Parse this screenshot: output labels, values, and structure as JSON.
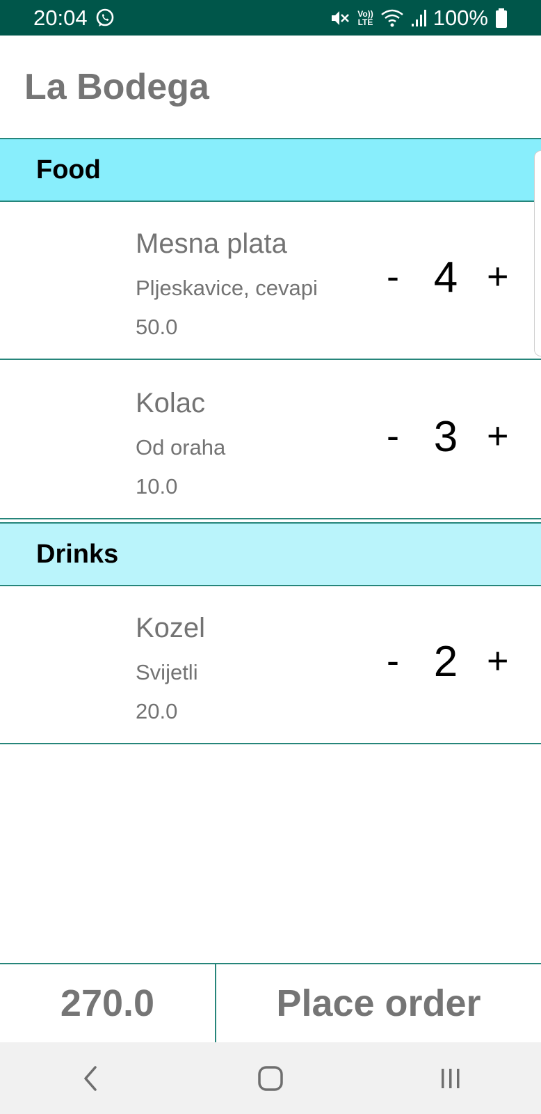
{
  "status_bar": {
    "time": "20:04",
    "battery_text": "100%",
    "volte_top": "Vo))",
    "volte_bottom": "LTE",
    "icons": [
      "whatsapp-icon",
      "mute-icon",
      "volte-icon",
      "wifi-icon",
      "signal-icon",
      "battery-icon"
    ]
  },
  "app_bar": {
    "title": "La Bodega"
  },
  "colors": {
    "status_bar_bg": "#00564a",
    "section_header_food_bg": "#88eefc",
    "section_header_drinks_bg": "#baf4fb",
    "divider": "#26857a",
    "muted_text": "#757575"
  },
  "menu": {
    "sections": [
      {
        "title": "Food",
        "items": [
          {
            "name": "Mesna plata",
            "description": "Pljeskavice, cevapi",
            "price": "50.0",
            "quantity": "4",
            "minus": "-",
            "plus": "+"
          },
          {
            "name": "Kolac",
            "description": "Od oraha",
            "price": "10.0",
            "quantity": "3",
            "minus": "-",
            "plus": "+"
          }
        ]
      },
      {
        "title": "Drinks",
        "items": [
          {
            "name": "Kozel",
            "description": "Svijetli",
            "price": "20.0",
            "quantity": "2",
            "minus": "-",
            "plus": "+"
          }
        ]
      }
    ]
  },
  "footer": {
    "total": "270.0",
    "order_button": "Place order"
  },
  "nav_bar": {
    "buttons": [
      "back-icon",
      "home-icon",
      "recents-icon"
    ]
  }
}
